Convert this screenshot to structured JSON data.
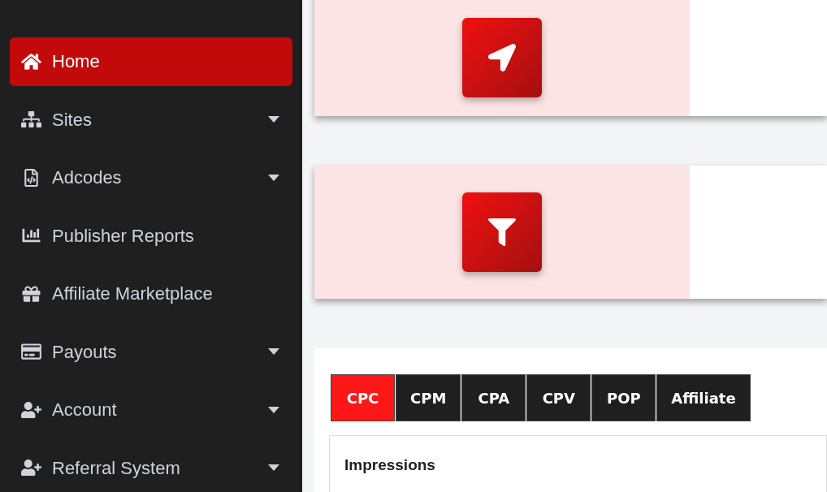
{
  "sidebar": {
    "items": [
      {
        "label": "Home",
        "selected": true,
        "kind": "link"
      },
      {
        "label": "Sites",
        "selected": false,
        "kind": "dropdown"
      },
      {
        "label": "Adcodes",
        "selected": false,
        "kind": "dropdown"
      },
      {
        "label": "Publisher Reports",
        "selected": false,
        "kind": "link"
      },
      {
        "label": "Affiliate Marketplace",
        "selected": false,
        "kind": "link"
      },
      {
        "label": "Payouts",
        "selected": false,
        "kind": "dropdown"
      },
      {
        "label": "Account",
        "selected": false,
        "kind": "dropdown"
      },
      {
        "label": "Referral System",
        "selected": false,
        "kind": "dropdown"
      }
    ]
  },
  "stat_cards": [
    {
      "kind": "location"
    },
    {
      "kind": "filter"
    }
  ],
  "report": {
    "tabs": [
      {
        "label": "CPC",
        "selected": true
      },
      {
        "label": "CPM",
        "selected": false
      },
      {
        "label": "CPA",
        "selected": false
      },
      {
        "label": "CPV",
        "selected": false
      },
      {
        "label": "POP",
        "selected": false
      },
      {
        "label": "Affiliate",
        "selected": false
      }
    ],
    "panel_title": "Impressions"
  }
}
